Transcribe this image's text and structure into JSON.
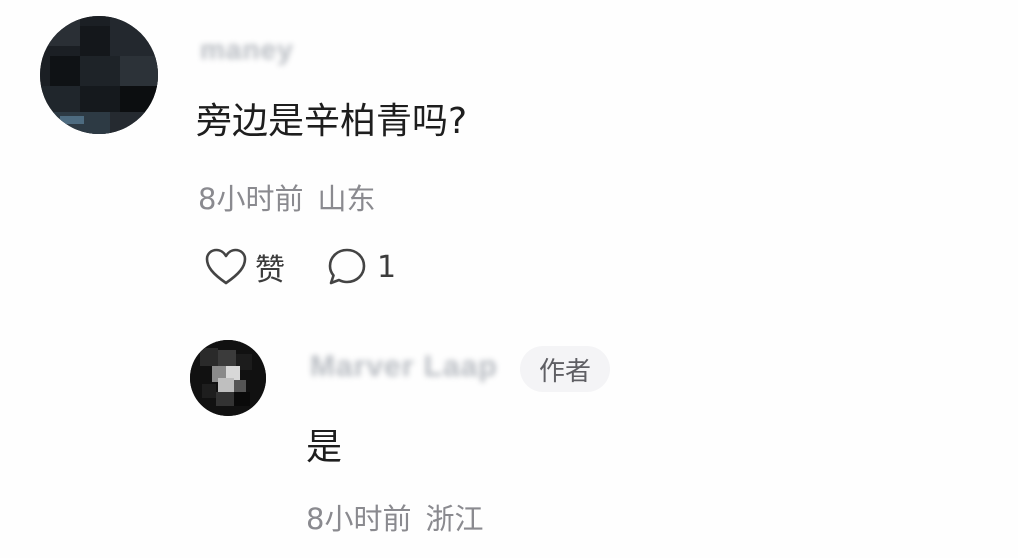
{
  "comment": {
    "avatar": "user-avatar-pixelated",
    "username": "maney",
    "text": "旁边是辛柏青吗?",
    "time": "8小时前",
    "location": "山东",
    "like_icon": "heart-icon",
    "like_label": "赞",
    "comment_icon": "comment-bubble-icon",
    "reply_count": "1"
  },
  "reply": {
    "avatar": "author-avatar-pixelated",
    "username": "Marver Laap",
    "badge": "作者",
    "text": "是",
    "time": "8小时前",
    "location": "浙江"
  },
  "colors": {
    "background": "#fefefe",
    "text_primary": "#1e1e1e",
    "text_secondary": "#8a8a8f",
    "badge_bg": "#f4f4f6",
    "username_blur": "#b8bcc2"
  }
}
